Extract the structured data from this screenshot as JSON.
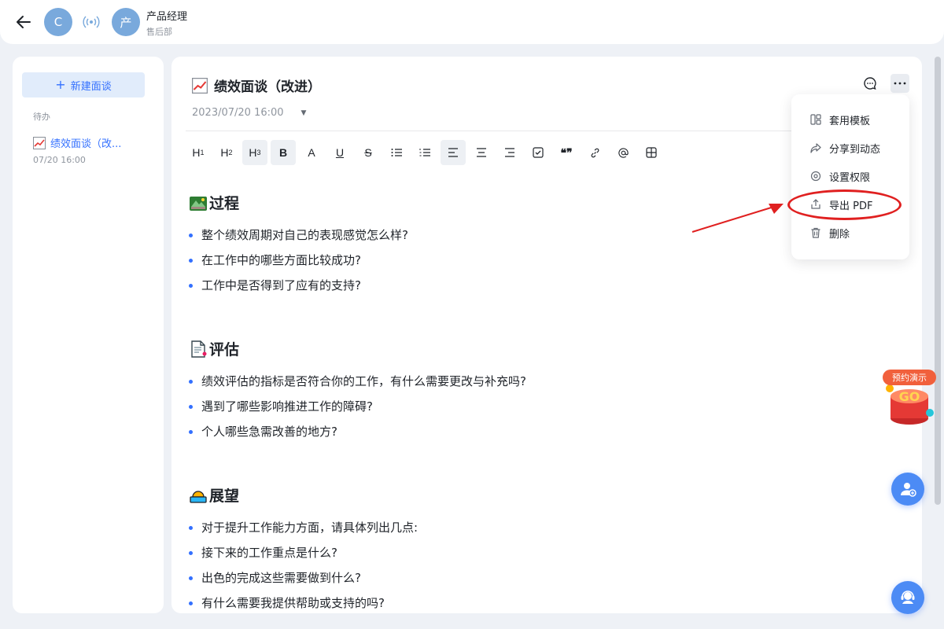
{
  "header": {
    "avatar1": "C",
    "avatar2": "产",
    "user_name": "产品经理",
    "user_dept": "售后部"
  },
  "sidebar": {
    "new_button": "新建面谈",
    "section_label": "待办",
    "items": [
      {
        "title": "绩效面谈（改...",
        "time": "07/20 16:00"
      }
    ]
  },
  "doc": {
    "title": "绩效面谈（改进）",
    "datetime": "2023/07/20 16:00"
  },
  "toolbar": {
    "h1": "H",
    "h2": "H",
    "h3": "H",
    "h1_sub": "1",
    "h2_sub": "2",
    "h3_sub": "3",
    "bold": "B",
    "font": "A",
    "underline": "U",
    "strike": "S",
    "quote": "❝❞"
  },
  "sections": [
    {
      "title": "过程",
      "items": [
        "整个绩效周期对自己的表现感觉怎么样?",
        "在工作中的哪些方面比较成功?",
        "工作中是否得到了应有的支持?"
      ]
    },
    {
      "title": "评估",
      "items": [
        "绩效评估的指标是否符合你的工作，有什么需要更改与补充吗?",
        "遇到了哪些影响推进工作的障碍?",
        "个人哪些急需改善的地方?"
      ]
    },
    {
      "title": "展望",
      "items": [
        "对于提升工作能力方面，请具体列出几点:",
        "接下来的工作重点是什么?",
        "出色的完成这些需要做到什么?",
        "有什么需要我提供帮助或支持的吗?"
      ]
    }
  ],
  "menu": {
    "items": [
      "套用模板",
      "分享到动态",
      "设置权限",
      "导出 PDF",
      "删除"
    ]
  },
  "promo": {
    "tag": "预约演示",
    "badge": "GO"
  },
  "colors": {
    "accent": "#3370ff",
    "highlight": "#e02020"
  }
}
